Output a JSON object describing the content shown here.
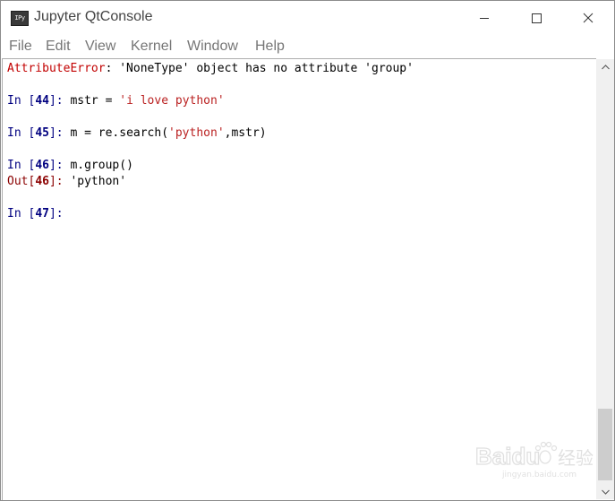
{
  "window": {
    "title": "Jupyter QtConsole",
    "icon_text": "IPy",
    "icon": "ipython-app-icon",
    "controls": [
      "minimize-icon",
      "maximize-icon",
      "close-icon"
    ]
  },
  "menu": [
    "File",
    "Edit",
    "View",
    "Kernel",
    "Window",
    "Help"
  ],
  "console": {
    "error": {
      "name": "AttributeError",
      "message": ": 'NoneType' object has no attribute 'group'"
    },
    "cells": [
      {
        "in_prefix": "In [",
        "num": "44",
        "in_suffix": "]: ",
        "code_before": "mstr = ",
        "code_string": "'i love python'",
        "code_after": ""
      },
      {
        "in_prefix": "In [",
        "num": "45",
        "in_suffix": "]: ",
        "code_before": "m = re.search(",
        "code_string": "'python'",
        "code_after": ",mstr)"
      },
      {
        "in_prefix": "In [",
        "num": "46",
        "in_suffix": "]: ",
        "code_before": "m.group()",
        "code_string": "",
        "code_after": "",
        "out_prefix": "Out[",
        "out_num": "46",
        "out_suffix": "]: ",
        "out_value": "'python'"
      },
      {
        "in_prefix": "In [",
        "num": "47",
        "in_suffix": "]: ",
        "code_before": "",
        "code_string": "",
        "code_after": ""
      }
    ]
  },
  "watermark": {
    "brand": "Baidu",
    "cn": "经验",
    "url": "jingyan.baidu.com"
  },
  "colors": {
    "error": "#c20000",
    "prompt_in": "#000080",
    "prompt_out": "#8b0000",
    "string": "#ba2121",
    "menu_text": "#767676"
  }
}
